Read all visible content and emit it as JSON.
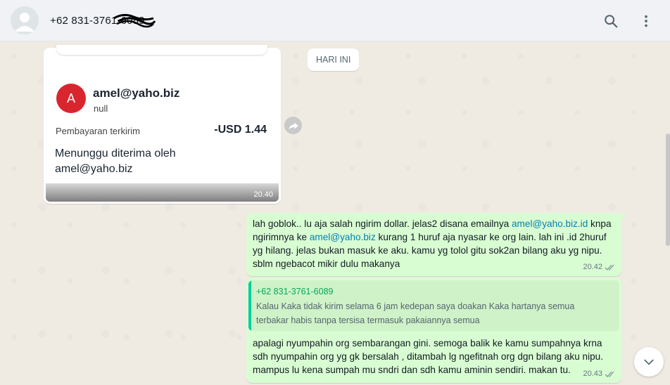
{
  "header": {
    "contact_name": "+62 831-3761-6089"
  },
  "icons": {
    "search": "search-icon",
    "menu": "more-vertical-icon",
    "forward": "forward-icon",
    "scroll_down": "chevron-down-icon"
  },
  "date_chip": "HARI INI",
  "payment_card": {
    "avatar_letter": "A",
    "recipient": "amel@yaho.biz",
    "recipient_sub": "null",
    "payment_label": "Pembayaran terkirim",
    "amount": "-USD 1.44",
    "status_line": "Menunggu diterima oleh amel@yaho.biz",
    "time": "20.40"
  },
  "messages": [
    {
      "parts": [
        {
          "text": "lah goblok.. lu aja salah ngirim dollar. jelas2 disana emailnya ",
          "link": false
        },
        {
          "text": "amel@yaho.biz.id",
          "link": true
        },
        {
          "text": " knpa ngirimnya ke ",
          "link": false
        },
        {
          "text": "amel@yaho.biz",
          "link": true
        },
        {
          "text": " kurang 1 huruf aja nyasar ke org lain. lah ini .id 2huruf yg hilang. jelas bukan masuk ke aku. kamu yg tolol gitu sok2an bilang aku yg nipu. sblm ngebacot mikir dulu makanya",
          "link": false
        }
      ],
      "time": "20.42"
    },
    {
      "quote_author": "+62 831-3761-6089",
      "quote_text": "Kalau Kaka tidak kirim selama 6 jam kedepan saya doakan Kaka hartanya semua terbakar habis tanpa tersisa termasuk pakaiannya semua",
      "text": "apalagi nyumpahin org sembarangan gini. semoga balik ke kamu sumpahnya krna sdh nyumpahin org yg gk bersalah , ditambah lg ngefitnah org dgn bilang aku nipu. mampus lu kena sumpah mu sndri dan sdh kamu aminin sendiri. makan tu.",
      "time": "20.43"
    }
  ]
}
